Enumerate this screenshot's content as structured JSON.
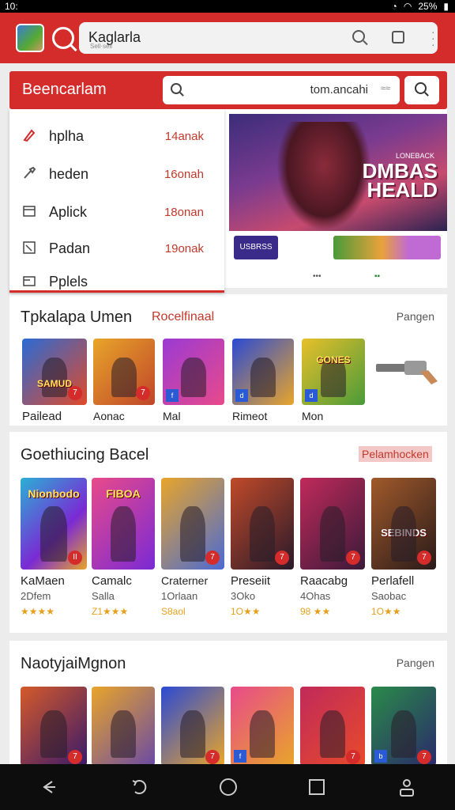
{
  "status": {
    "left": "10:",
    "right": "25%"
  },
  "appbar": {
    "search_value": "Kaglarla",
    "search_sub": "Sell·sell"
  },
  "search_panel": {
    "title": "Beencarlam",
    "input_value": "tom.ancahi",
    "input_extra": "≈≈"
  },
  "dropdown": {
    "items": [
      {
        "label": "hplha",
        "value": "14anak",
        "icon": "pencil-icon"
      },
      {
        "label": "heden",
        "value": "16onah",
        "icon": "brush-icon"
      },
      {
        "label": "Aplick",
        "value": "18onan",
        "icon": "window-icon"
      },
      {
        "label": "Padan",
        "value": "19onak",
        "icon": "image-icon"
      },
      {
        "label": "Pplels",
        "value": "",
        "icon": "folder-icon"
      }
    ]
  },
  "banner": {
    "kicker": "LONEBACK",
    "title_line1": "DMBAS",
    "title_line2": "HEALD",
    "chip1": "USBRSS",
    "chip2": ""
  },
  "section1": {
    "title": "Tpkalapa Umen",
    "tag": "Rocelfinaal",
    "more": "Pangen",
    "tiles": [
      {
        "name": "Pailead",
        "art": "SAMUD",
        "badge": "7"
      },
      {
        "name": "Aonac",
        "art": "",
        "badge": "7"
      },
      {
        "name": "Mal",
        "art": "",
        "badge": ""
      },
      {
        "name": "Rimeot",
        "art": "",
        "badge": ""
      },
      {
        "name": "Mon",
        "art": "GONES",
        "badge": ""
      }
    ]
  },
  "section2": {
    "title": "Goethiucing Bacel",
    "more": "Pelamhocken",
    "tiles": [
      {
        "name": "KaMaen",
        "sub": "2Dfem",
        "stars": "★★★★",
        "art": "Nionbodo",
        "badge": "II"
      },
      {
        "name": "Camalc",
        "sub": "Salla",
        "stars": "Z1★★★",
        "art": "FIBOA",
        "badge": ""
      },
      {
        "name": "Craterner",
        "sub": "1Orlaan",
        "stars": "S8aol",
        "art": "",
        "badge": "7"
      },
      {
        "name": "Preseiit",
        "sub": "3Oko",
        "stars": "1O★★",
        "art": "",
        "badge": "7"
      },
      {
        "name": "Raacabg",
        "sub": "4Ohas",
        "stars": "98 ★★",
        "art": "",
        "badge": "7"
      },
      {
        "name": "Perlafell",
        "sub": "Saobac",
        "stars": "1O★★",
        "art": "SEBINDS",
        "badge": "7"
      }
    ]
  },
  "section3": {
    "title": "NaotyjaiMgnon",
    "more": "Pangen",
    "tiles": [
      {
        "badge": "7"
      },
      {
        "badge": ""
      },
      {
        "badge": "7"
      },
      {
        "badge": ""
      },
      {
        "badge": "7"
      },
      {
        "badge": "7"
      }
    ]
  },
  "colors": {
    "brand": "#d42b2b",
    "tag": "#c0392b",
    "star": "#e5a11e"
  }
}
